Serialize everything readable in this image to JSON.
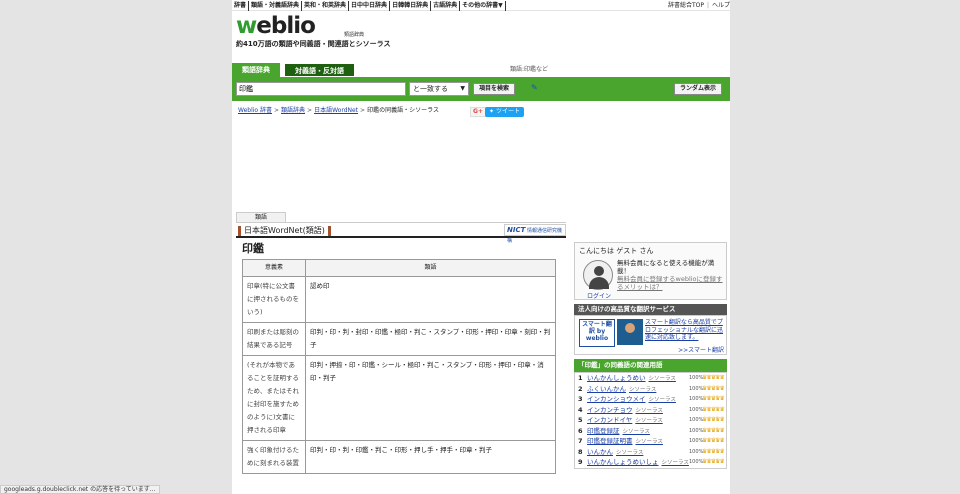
{
  "topnav": [
    "辞書",
    "類語・対義語辞典",
    "英和・和英辞典",
    "日中中日辞典",
    "日韓韓日辞典",
    "古語辞典",
    "その他の辞書▼"
  ],
  "toplinks": {
    "home": "辞書総合TOP",
    "sep": "|",
    "help": "ヘルプ"
  },
  "header": {
    "logo_w": "w",
    "logo_rest": "eblio",
    "logo_sub": "類語辞典",
    "tagline": "約410万語の類語や同義語・関連語とシソーラス"
  },
  "tabs": [
    "類語辞典",
    "対義語・反対語"
  ],
  "ruijirei": "類語:印鑑など",
  "search": {
    "query": "印鑑",
    "match": "と一致する",
    "search_button": "項目を検索",
    "random_button": "ランダム表示"
  },
  "breadcrumb": {
    "items": [
      "Weblio 辞書",
      "類語辞典",
      "日本語WordNet"
    ],
    "current": "印鑑の同義語・シソーラス"
  },
  "social": {
    "gplus": "G+",
    "tweet": "ツイート"
  },
  "dict": {
    "tab": "類語",
    "title": "日本語WordNet(類語)",
    "nict_logo": "NICT",
    "nict_label": "情報通信研究機構"
  },
  "entry": {
    "headword": "印鑑",
    "col_meaning": "意義素",
    "col_synonyms": "類語",
    "rows": [
      {
        "meaning": "印章(特に公文書に押されるものをいう)",
        "synonyms": "認め印"
      },
      {
        "meaning": "印刷または彫刻の結果である記号",
        "synonyms": "印判・印・判・封印・印鑑・極印・判こ・スタンプ・印形・押印・印章・刻印・判子"
      },
      {
        "meaning": "(それが本物であることを証明するため、またはそれに封印を施すためのように)文書に押される印章",
        "synonyms": "印判・押捺・印・印鑑・シール・極印・判こ・スタンプ・印形・押印・印章・消印・判子"
      },
      {
        "meaning": "強く印象付けるために刻まれる装置",
        "synonyms": "印判・印・判・印鑑・判こ・印形・押し手・押手・印章・判子"
      }
    ]
  },
  "sidebar": {
    "greeting": "こんにちは ゲスト さん",
    "login": "ログイン",
    "member_msg": "無料会員になると使える機能が満載！",
    "member_link": "無料会員に登録するweblioに登録するメリットは？",
    "pro_header": "法人向けの高品質な翻訳サービス",
    "pro_logo": "スマート翻訳 by weblio",
    "pro_text": "スマート翻訳なら高品質でプロフェッショナルな翻訳に迅速に対応致します。",
    "pro_more": ">>スマート翻訳",
    "related_header": "「印鑑」の同義語の関連用語",
    "related": [
      {
        "no": "1",
        "word": "いんかんしょうめい",
        "source": "シソーラス",
        "pct": "100%",
        "crowns": "♛♛♛♛♛"
      },
      {
        "no": "2",
        "word": "ふくいんかん",
        "source": "シソーラス",
        "pct": "100%",
        "crowns": "♛♛♛♛♛"
      },
      {
        "no": "3",
        "word": "インカンショウメイ",
        "source": "シソーラス",
        "pct": "100%",
        "crowns": "♛♛♛♛♛"
      },
      {
        "no": "4",
        "word": "インカンチョウ",
        "source": "シソーラス",
        "pct": "100%",
        "crowns": "♛♛♛♛♛"
      },
      {
        "no": "5",
        "word": "インカンドイヤ",
        "source": "シソーラス",
        "pct": "100%",
        "crowns": "♛♛♛♛♛"
      },
      {
        "no": "6",
        "word": "印鑑登録証",
        "source": "シソーラス",
        "pct": "100%",
        "crowns": "♛♛♛♛♛"
      },
      {
        "no": "7",
        "word": "印鑑登録証明書",
        "source": "シソーラス",
        "pct": "100%",
        "crowns": "♛♛♛♛♛"
      },
      {
        "no": "8",
        "word": "いんかん",
        "source": "シソーラス",
        "pct": "100%",
        "crowns": "♛♛♛♛♛"
      },
      {
        "no": "9",
        "word": "いんかんしょうめいしょ",
        "source": "シソーラス",
        "pct": "100%",
        "crowns": "♛♛♛♛♛"
      }
    ]
  },
  "status_bar": "googleads.g.doubleclick.net の応答を待っています..."
}
